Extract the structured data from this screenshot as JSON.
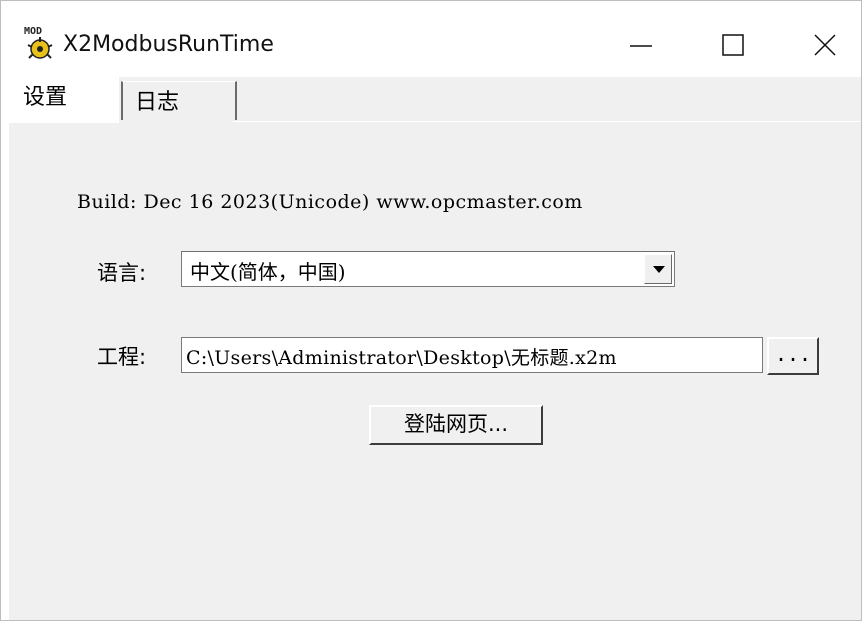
{
  "window": {
    "title": "X2ModbusRunTime",
    "icon_badge": "MOD",
    "icon": "mod-app-icon"
  },
  "controls": {
    "minimize_icon": "minimize-icon",
    "maximize_icon": "maximize-icon",
    "close_icon": "close-icon"
  },
  "tabs": [
    {
      "label": "设置",
      "active": true
    },
    {
      "label": "日志",
      "active": false
    }
  ],
  "settings": {
    "build_info": "Build: Dec 16 2023(Unicode) www.opcmaster.com",
    "language_label": "语言:",
    "language_value": "中文(简体，中国)",
    "project_label": "工程:",
    "project_path": "C:\\Users\\Administrator\\Desktop\\无标题.x2m",
    "browse_button": "...",
    "login_button": "登陆网页..."
  },
  "colors": {
    "panel_bg": "#f0f0f0",
    "window_bg": "#ffffff",
    "icon_yellow": "#e8c21a"
  }
}
